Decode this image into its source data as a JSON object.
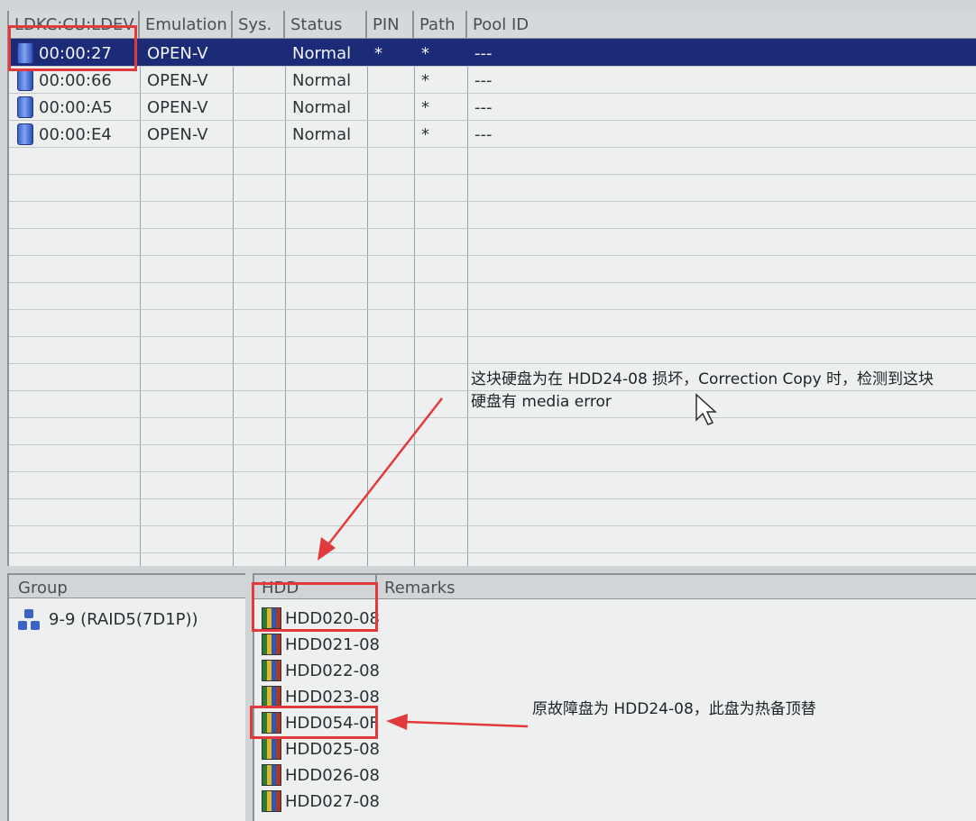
{
  "ldev_table": {
    "columns": [
      "LDKC:CU:LDEV",
      "Emulation",
      "Sys.",
      "Status",
      "PIN",
      "Path",
      "Pool ID"
    ],
    "rows": [
      {
        "ldev": "00:00:27",
        "emulation": "OPEN-V",
        "sys": "",
        "status": "Normal",
        "pin": "*",
        "path": "*",
        "pool_id": "---",
        "selected": true
      },
      {
        "ldev": "00:00:66",
        "emulation": "OPEN-V",
        "sys": "",
        "status": "Normal",
        "pin": "",
        "path": "*",
        "pool_id": "---",
        "selected": false
      },
      {
        "ldev": "00:00:A5",
        "emulation": "OPEN-V",
        "sys": "",
        "status": "Normal",
        "pin": "",
        "path": "*",
        "pool_id": "---",
        "selected": false
      },
      {
        "ldev": "00:00:E4",
        "emulation": "OPEN-V",
        "sys": "",
        "status": "Normal",
        "pin": "",
        "path": "*",
        "pool_id": "---",
        "selected": false
      }
    ],
    "icon": "ldev-disk-icon"
  },
  "group_panel": {
    "header": "Group",
    "items": [
      {
        "label": "9-9 (RAID5(7D1P))",
        "icon": "raid-group-icon"
      }
    ]
  },
  "hdd_panel": {
    "columns": [
      "HDD",
      "Remarks"
    ],
    "items": [
      "HDD020-08",
      "HDD021-08",
      "HDD022-08",
      "HDD023-08",
      "HDD054-0F",
      "HDD025-08",
      "HDD026-08",
      "HDD027-08"
    ],
    "icon": "hdd-drive-icon"
  },
  "annotations": {
    "note1_line1": "这块硬盘为在 HDD24-08 损坏，Correction Copy 时，检测到这块",
    "note1_line2": "硬盘有 media error",
    "note2": "原故障盘为 HDD24-08，此盘为热备顶替",
    "accent_color": "#e23a3a"
  }
}
